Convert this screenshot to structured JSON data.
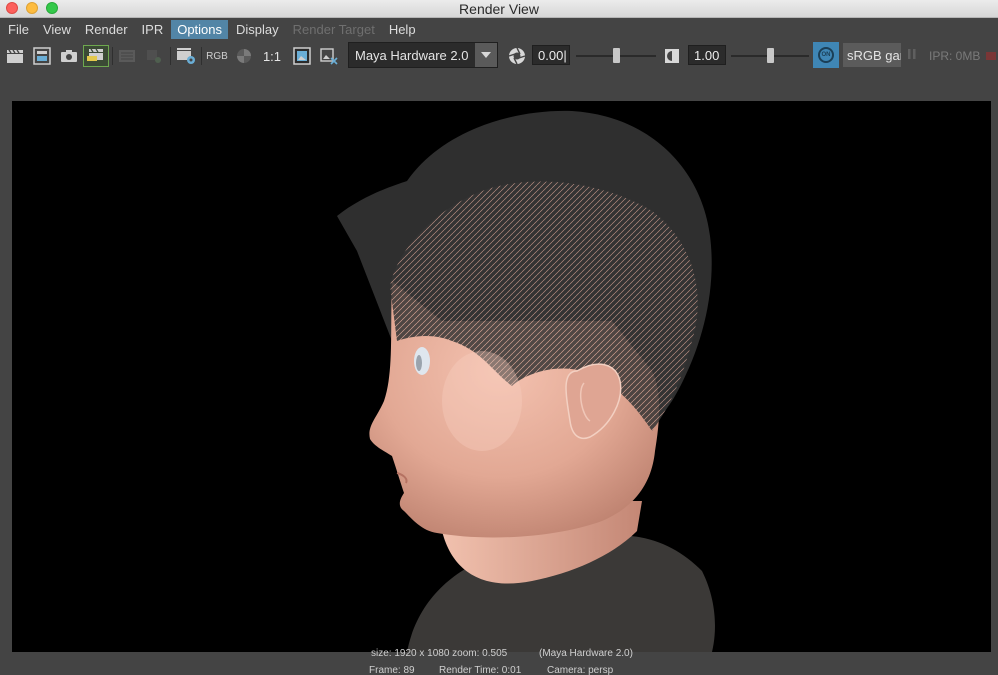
{
  "window": {
    "title": "Render View"
  },
  "menu": {
    "items": [
      {
        "label": "File"
      },
      {
        "label": "View"
      },
      {
        "label": "Render"
      },
      {
        "label": "IPR"
      },
      {
        "label": "Options",
        "active": true
      },
      {
        "label": "Display"
      },
      {
        "label": "Render Target",
        "disabled": true
      },
      {
        "label": "Help"
      }
    ]
  },
  "toolbar": {
    "channel_label": "RGB",
    "ratio_label": "1:1",
    "renderer": "Maya Hardware 2.0",
    "exposure_value": "0.00",
    "exposure_level": 0.5,
    "gamma_value": "1.00",
    "gamma_level": 0.5,
    "color_mgmt_badge": "ON",
    "color_space": "sRGB gam",
    "ipr_memory": "IPR: 0MB"
  },
  "render_info": {
    "size_zoom": "size: 1920 x 1080 zoom: 0.505",
    "renderer_note": "(Maya Hardware 2.0)",
    "frame": "Frame: 89",
    "render_time": "Render Time: 0:01",
    "camera": "Camera: persp"
  },
  "colors": {
    "accent": "#5285a6",
    "on_button": "#3f86b5",
    "skin": "#e2aa98",
    "hair": "#2e2e2e",
    "shirt": "#3a3836"
  }
}
